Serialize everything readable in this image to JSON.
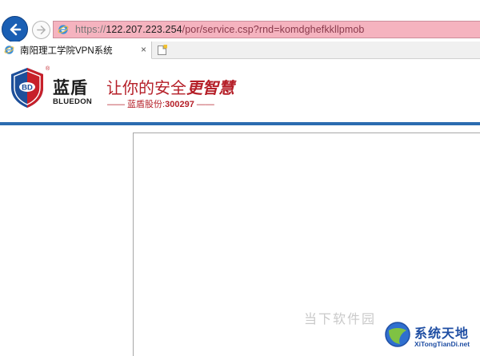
{
  "browser": {
    "address": {
      "scheme": "https://",
      "host": "122.207.223.254",
      "path": "/por/service.csp?rnd=komdghefkkllpmob"
    },
    "tab": {
      "title": "南阳理工学院VPN系统",
      "close_glyph": "×"
    },
    "colors": {
      "address_bar_warning": "#f5b3bf",
      "back_button": "#1a5fb4"
    }
  },
  "header": {
    "logo_letters": "BD",
    "registered_mark": "®",
    "brand_cn": "蓝盾",
    "brand_en": "BLUEDON",
    "slogan_prefix": "让你的安全",
    "slogan_script": "更智慧",
    "stock_label": "—— 蓝盾股份:",
    "stock_code": "300297",
    "stock_suffix": " ——",
    "accent_color": "#2b6cb0",
    "slogan_color": "#b51f28"
  },
  "overlays": {
    "watermark_text": "当下软件园",
    "badge_name": "系统天地",
    "badge_url": "XiTongTianDi.net"
  },
  "icons": {
    "back": "back-arrow-icon",
    "forward": "forward-arrow-icon",
    "ie": "ie-page-icon",
    "new_tab": "new-tab-icon"
  }
}
